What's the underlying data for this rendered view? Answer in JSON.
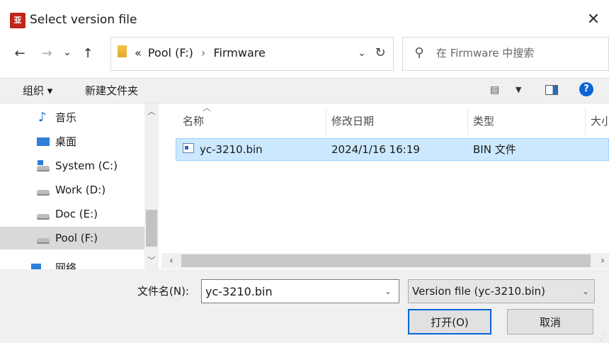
{
  "window": {
    "title": "Select version file",
    "app_icon_text": "亚",
    "close_glyph": "✕"
  },
  "nav": {
    "back_glyph": "←",
    "forward_glyph": "→",
    "recent_glyph": "⌄",
    "up_glyph": "↑",
    "breadcrumb_overflow": "«",
    "breadcrumb": [
      "Pool (F:)",
      "Firmware"
    ],
    "breadcrumb_sep": "›",
    "dropdown_glyph": "⌄",
    "refresh_glyph": "↻",
    "search_placeholder": "在 Firmware 中搜索"
  },
  "commandbar": {
    "organize_label": "组织 ▾",
    "new_folder_label": "新建文件夹",
    "help_label": "?"
  },
  "sidebar": {
    "items": [
      {
        "label": "音乐",
        "icon": "music-icon"
      },
      {
        "label": "桌面",
        "icon": "desktop-icon"
      },
      {
        "label": "System (C:)",
        "icon": "system-drive-icon"
      },
      {
        "label": "Work (D:)",
        "icon": "drive-icon"
      },
      {
        "label": "Doc (E:)",
        "icon": "drive-icon"
      },
      {
        "label": "Pool (F:)",
        "icon": "drive-icon",
        "selected": true
      },
      {
        "label": "网络",
        "icon": "network-icon"
      }
    ]
  },
  "filelist": {
    "columns": [
      "名称",
      "修改日期",
      "类型",
      "大小"
    ],
    "rows": [
      {
        "name": "yc-3210.bin",
        "modified": "2024/1/16 16:19",
        "type": "BIN 文件",
        "selected": true
      }
    ]
  },
  "footer": {
    "filename_label": "文件名(N):",
    "filename_value": "yc-3210.bin",
    "filetype_value": "Version file  (yc-3210.bin)",
    "open_label": "打开(O)",
    "cancel_label": "取消"
  },
  "colors": {
    "accent": "#0b64d8",
    "selection": "#cce8ff",
    "app_icon": "#c0271c",
    "chrome": "#f0f0f0"
  }
}
